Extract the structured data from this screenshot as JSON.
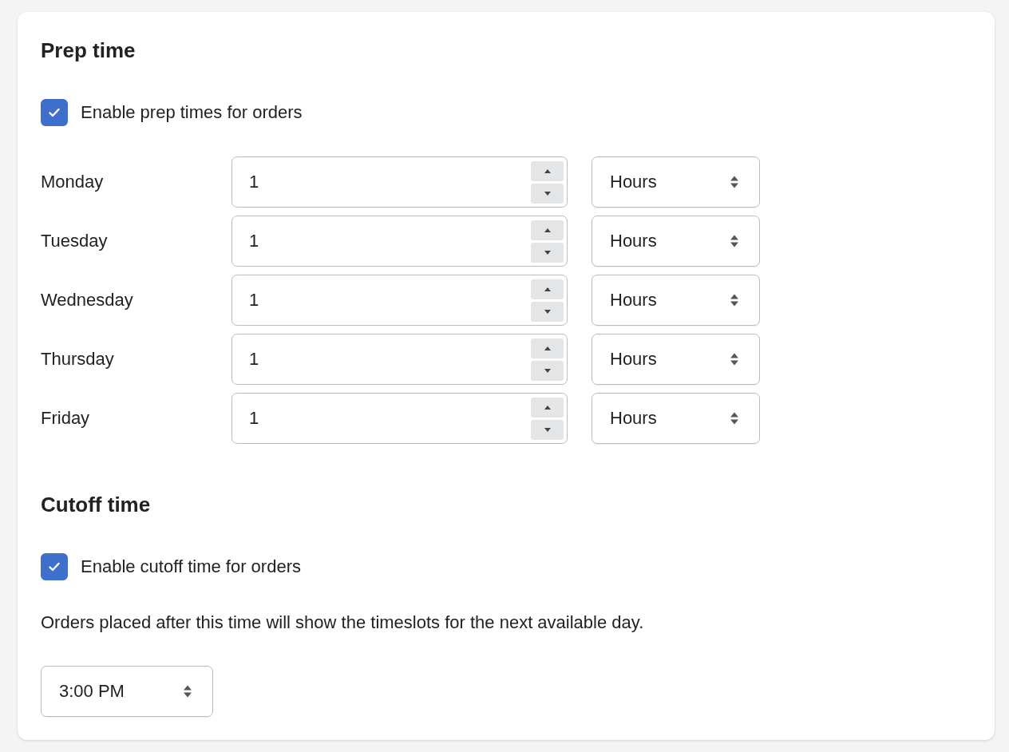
{
  "prep_time": {
    "heading": "Prep time",
    "enable": {
      "label": "Enable prep times for orders",
      "checked": true
    },
    "days": [
      {
        "day": "Monday",
        "value": "1",
        "unit": "Hours"
      },
      {
        "day": "Tuesday",
        "value": "1",
        "unit": "Hours"
      },
      {
        "day": "Wednesday",
        "value": "1",
        "unit": "Hours"
      },
      {
        "day": "Thursday",
        "value": "1",
        "unit": "Hours"
      },
      {
        "day": "Friday",
        "value": "1",
        "unit": "Hours"
      }
    ]
  },
  "cutoff_time": {
    "heading": "Cutoff time",
    "enable": {
      "label": "Enable cutoff time for orders",
      "checked": true
    },
    "description": "Orders placed after this time will show the timeslots for the next available day.",
    "time": "3:00 PM"
  }
}
